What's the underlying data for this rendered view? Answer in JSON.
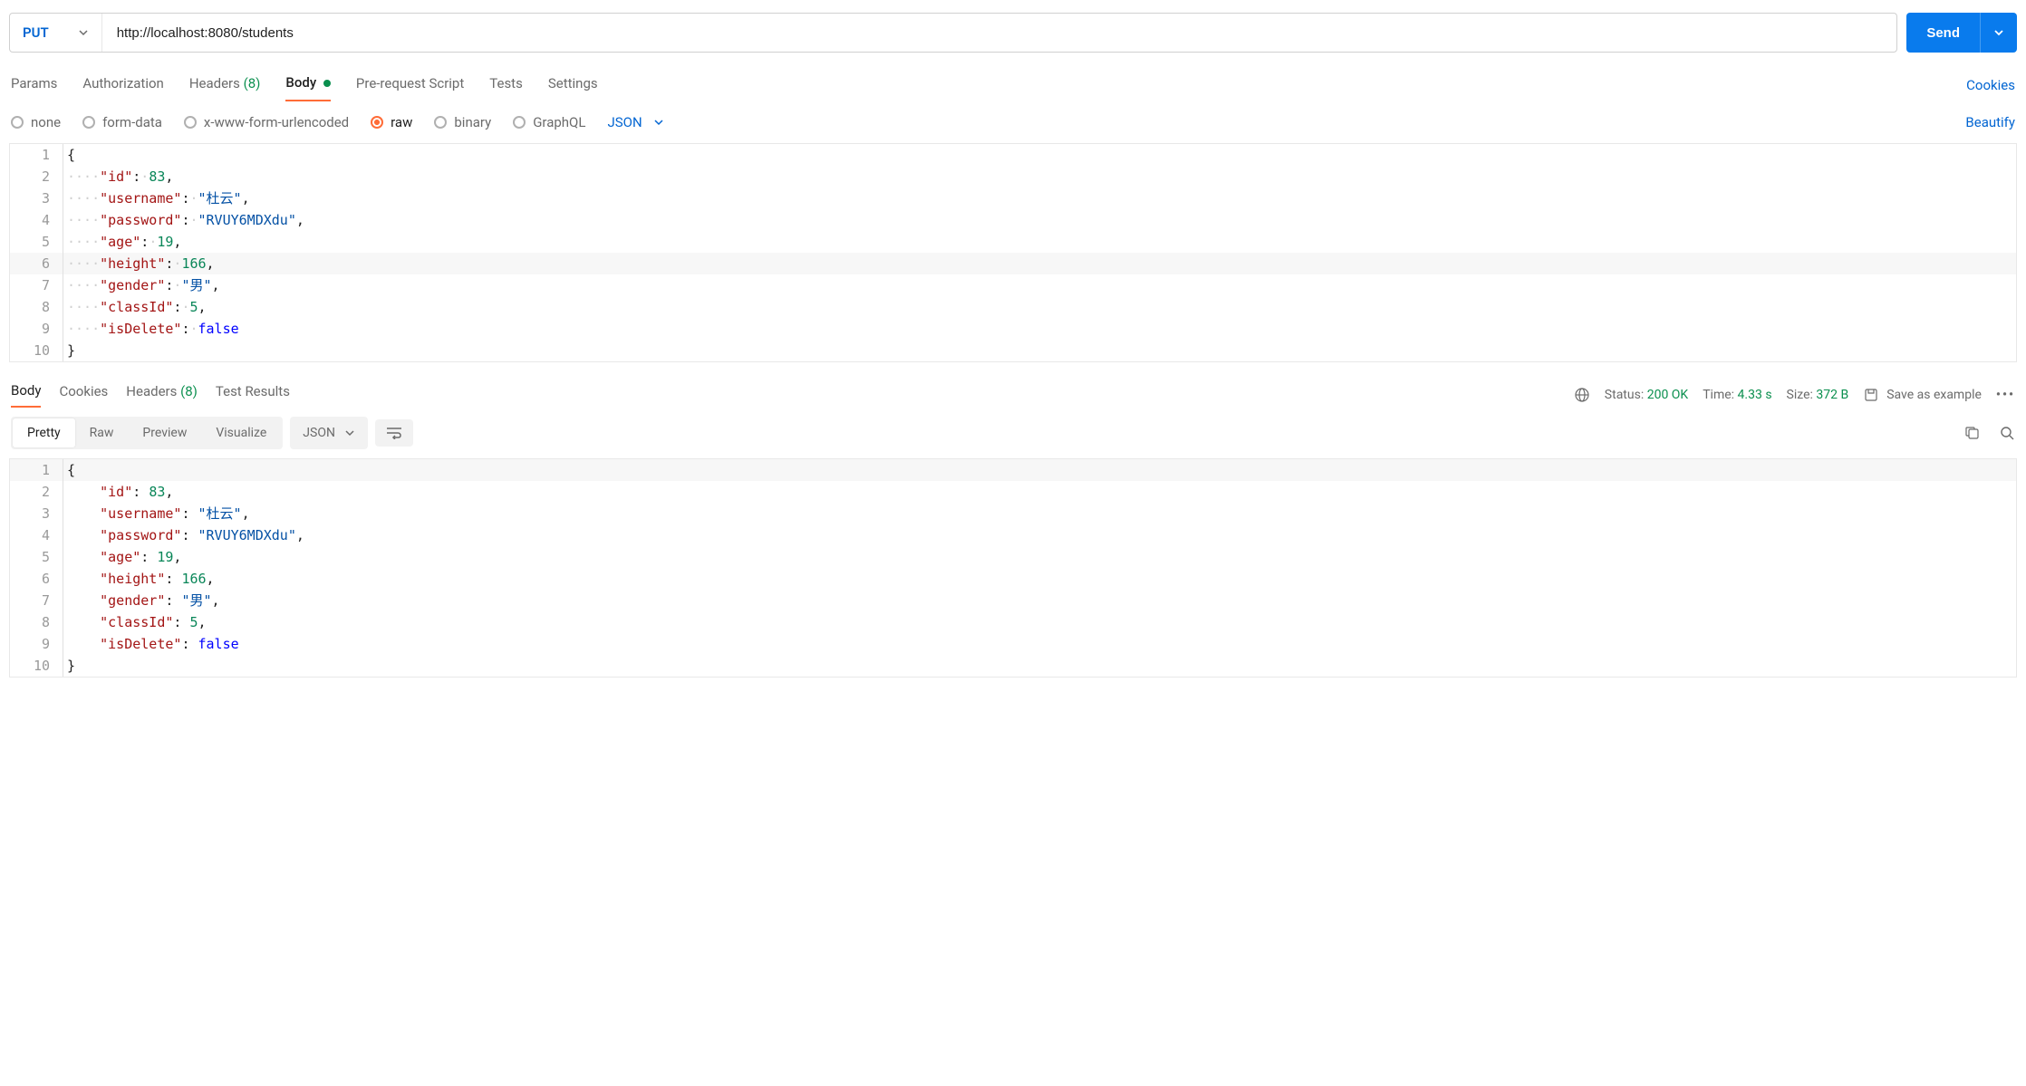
{
  "request": {
    "method": "PUT",
    "url": "http://localhost:8080/students",
    "send_label": "Send"
  },
  "req_tabs": {
    "params": "Params",
    "authorization": "Authorization",
    "headers_label": "Headers",
    "headers_count": "(8)",
    "body": "Body",
    "prerequest": "Pre-request Script",
    "tests": "Tests",
    "settings": "Settings",
    "cookies": "Cookies"
  },
  "body_types": {
    "none": "none",
    "form_data": "form-data",
    "xwww": "x-www-form-urlencoded",
    "raw": "raw",
    "binary": "binary",
    "graphql": "GraphQL",
    "format": "JSON",
    "beautify": "Beautify"
  },
  "request_body": {
    "id": 83,
    "username": "杜云",
    "password": "RVUY6MDXdu",
    "age": 19,
    "height": 166,
    "gender": "男",
    "classId": 5,
    "isDelete": false
  },
  "resp_tabs": {
    "body": "Body",
    "cookies": "Cookies",
    "headers_label": "Headers",
    "headers_count": "(8)",
    "test_results": "Test Results"
  },
  "resp_meta": {
    "status_label": "Status:",
    "status_value": "200 OK",
    "time_label": "Time:",
    "time_value": "4.33 s",
    "size_label": "Size:",
    "size_value": "372 B",
    "save_example": "Save as example"
  },
  "resp_views": {
    "pretty": "Pretty",
    "raw": "Raw",
    "preview": "Preview",
    "visualize": "Visualize",
    "format": "JSON"
  },
  "response_body": {
    "id": 83,
    "username": "杜云",
    "password": "RVUY6MDXdu",
    "age": 19,
    "height": 166,
    "gender": "男",
    "classId": 5,
    "isDelete": false
  }
}
